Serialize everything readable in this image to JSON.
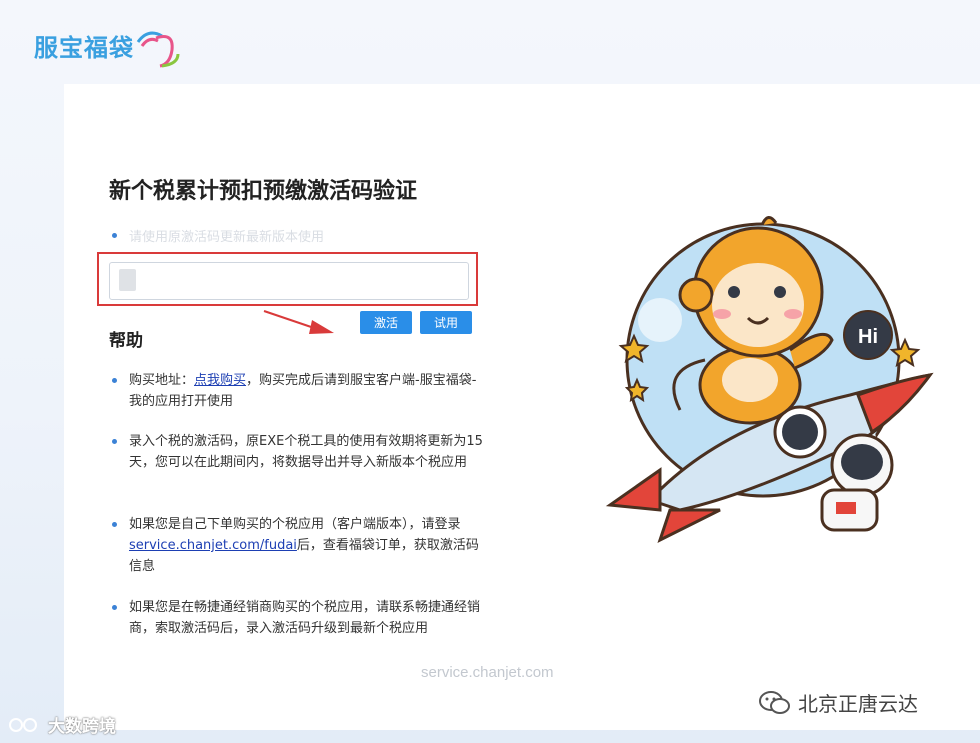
{
  "brand": {
    "logo_text": "服宝福袋"
  },
  "page": {
    "title": "新个税累计预扣预缴激活码验证",
    "hint": "请使用原激活码更新最新版本使用"
  },
  "activation": {
    "input_value": "",
    "activate_label": "激活",
    "trial_label": "试用"
  },
  "help": {
    "title": "帮助",
    "items": [
      {
        "before": "购买地址：",
        "link": "点我购买",
        "after": "，购买完成后请到服宝客户端-服宝福袋-我的应用打开使用"
      },
      {
        "text": "录入个税的激活码，原EXE个税工具的使用有效期将更新为15天，您可以在此期间内，将数据导出并导入新版本个税应用"
      },
      {
        "before": "如果您是自己下单购买的个税应用（客户端版本），请登录",
        "link": "service.chanjet.com/fudai",
        "after": "后，查看福袋订单，获取激活码信息"
      },
      {
        "text": "如果您是在畅捷通经销商购买的个税应用，请联系畅捷通经销商，索取激活码后，录入激活码升级到最新个税应用"
      }
    ]
  },
  "footer": {
    "link_text": "service.chanjet.com"
  },
  "illustration": {
    "speech_bubble": "Hi"
  },
  "watermarks": {
    "right": "北京正唐云达",
    "left": "大数跨境"
  },
  "colors": {
    "accent": "#2a8ee8",
    "highlight_box": "#d93a3a",
    "logo": "#3aa0e0"
  }
}
